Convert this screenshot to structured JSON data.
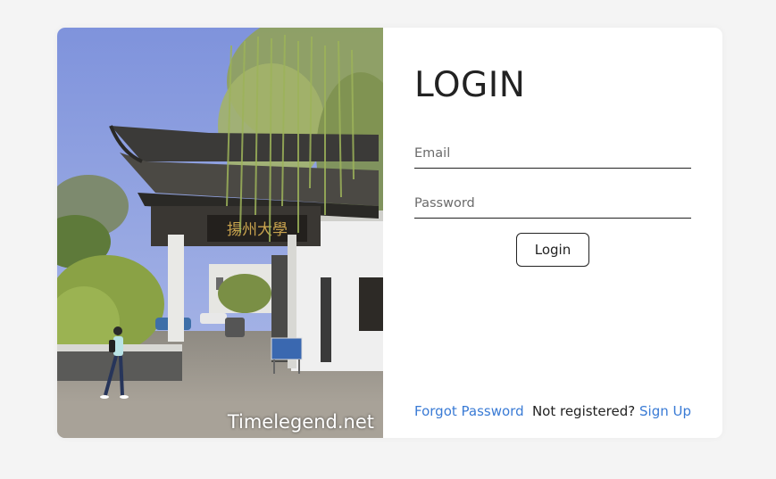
{
  "photo": {
    "caption": "Timelegend.net",
    "gate_sign": "揚州大學"
  },
  "login": {
    "title": "LOGIN",
    "email": {
      "placeholder": "Email",
      "value": ""
    },
    "password": {
      "placeholder": "Password",
      "value": ""
    },
    "submit_label": "Login"
  },
  "footer": {
    "forgot_label": "Forgot Password",
    "not_registered_text": "Not registered?",
    "signup_label": "Sign Up"
  },
  "colors": {
    "link": "#3a7bd5",
    "page_background": "#f4f4f4",
    "card_background": "#ffffff"
  }
}
